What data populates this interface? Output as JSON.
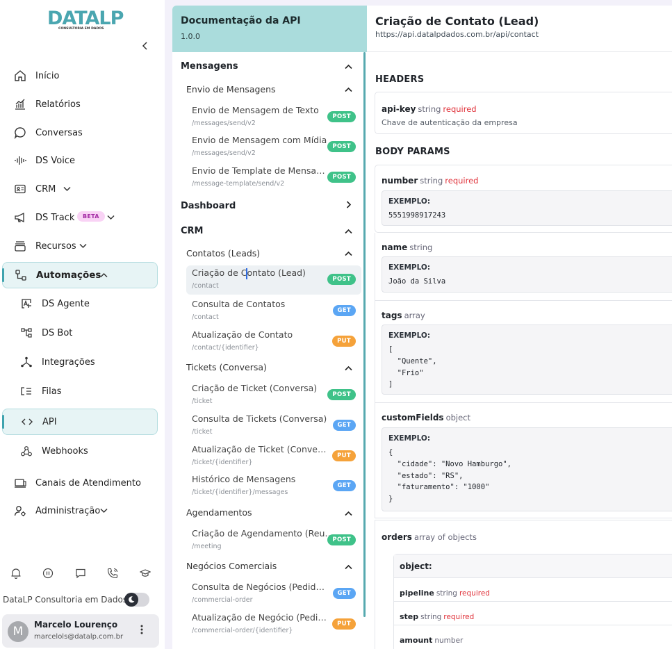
{
  "sidebar": {
    "logo_text": "DATALP",
    "logo_tagline": "CONSULTORIA EM DADOS",
    "items": [
      {
        "label": "Início",
        "icon": "home-icon"
      },
      {
        "label": "Relatórios",
        "icon": "chart-icon"
      },
      {
        "label": "Conversas",
        "icon": "chat-bubble-icon"
      },
      {
        "label": "DS Voice",
        "icon": "waveform-icon"
      },
      {
        "label": "CRM",
        "icon": "id-card-icon"
      },
      {
        "label": "DS Track",
        "icon": "megaphone-icon",
        "badge": "BETA"
      },
      {
        "label": "Recursos",
        "icon": "stack-icon"
      },
      {
        "label": "Automações",
        "icon": "workflow-icon"
      },
      {
        "label": "DS Agente",
        "icon": "ai-agent-icon"
      },
      {
        "label": "DS Bot",
        "icon": "bot-flow-icon"
      },
      {
        "label": "Integrações",
        "icon": "integration-icon"
      },
      {
        "label": "Filas",
        "icon": "queue-icon"
      },
      {
        "label": "API",
        "icon": "code-icon"
      },
      {
        "label": "Webhooks",
        "icon": "webhook-icon"
      },
      {
        "label": "Canais de Atendimento",
        "icon": "channels-icon"
      },
      {
        "label": "Administração",
        "icon": "admin-icon"
      }
    ],
    "org_name": "DataLP Consultoria em Dados",
    "user": {
      "initial": "M",
      "name": "Marcelo Lourenço",
      "email": "marcelols@datalp.com.br"
    },
    "accent": "#3fa3ae"
  },
  "docs": {
    "title": "Documentação da API",
    "version": "1.0.0",
    "sections": {
      "mensagens": "Mensagens",
      "envio": "Envio de Mensagens",
      "dashboard": "Dashboard",
      "crm": "CRM",
      "contatos": "Contatos (Leads)",
      "tickets": "Tickets (Conversa)",
      "agendamentos": "Agendamentos",
      "negocios": "Negócios Comerciais"
    },
    "endpoints": [
      {
        "name": "Envio de Mensagem de Texto",
        "path": "/messages/send/v2",
        "method": "POST"
      },
      {
        "name": "Envio de Mensagem com Mídia",
        "path": "/messages/send/v2",
        "method": "POST"
      },
      {
        "name": "Envio de Template de Mensagem",
        "path": "/message-template/send/v2",
        "method": "POST"
      },
      {
        "name": "Criação de Contato (Lead)",
        "path": "/contact",
        "method": "POST"
      },
      {
        "name": "Consulta de Contatos",
        "path": "/contact",
        "method": "GET"
      },
      {
        "name": "Atualização de Contato",
        "path": "/contact/{identifier}",
        "method": "PUT"
      },
      {
        "name": "Criação de Ticket (Conversa)",
        "path": "/ticket",
        "method": "POST"
      },
      {
        "name": "Consulta de Tickets (Conversa)",
        "path": "/ticket",
        "method": "GET"
      },
      {
        "name": "Atualização de Ticket (Conversa)",
        "path": "/ticket/{identifier}",
        "method": "PUT"
      },
      {
        "name": "Histórico de Mensagens",
        "path": "/ticket/{identifier}/messages",
        "method": "GET"
      },
      {
        "name": "Criação de Agendamento (Reunião)",
        "path": "/meeting",
        "method": "POST"
      },
      {
        "name": "Consulta de Negócios (Pedidos Co...",
        "path": "/commercial-order",
        "method": "GET"
      },
      {
        "name": "Atualização de Negócio (Pedido Co...",
        "path": "/commercial-order/{identifier}",
        "method": "PUT"
      }
    ],
    "method_colors": {
      "POST": "#3fc289",
      "GET": "#5ba6f4",
      "PUT": "#f5a23a"
    }
  },
  "main": {
    "title": "Criação de Contato (Lead)",
    "url": "https://api.datalpdados.com.br/api/contact",
    "headers_label": "HEADERS",
    "body_label": "BODY PARAMS",
    "example_label": "EXEMPLO:",
    "required_label": "required",
    "headers": [
      {
        "name": "api-key",
        "type": "string",
        "description": "Chave de autenticação da empresa"
      }
    ],
    "params": [
      {
        "name": "number",
        "type": "string",
        "example": "5551998917243"
      },
      {
        "name": "name",
        "type": "string",
        "example": "João da Silva"
      },
      {
        "name": "tags",
        "type": "array",
        "example": "[\n  \"Quente\",\n  \"Frio\"\n]"
      },
      {
        "name": "customFields",
        "type": "object",
        "example": "{\n  \"cidade\": \"Novo Hamburgo\",\n  \"estado\": \"RS\",\n  \"faturamento\": \"1000\"\n}"
      },
      {
        "name": "orders",
        "type": "array of objects"
      }
    ],
    "orders_object": {
      "label": "object:",
      "fields": [
        {
          "name": "pipeline",
          "type": "string"
        },
        {
          "name": "step",
          "type": "string"
        },
        {
          "name": "amount",
          "type": "number"
        }
      ]
    }
  }
}
